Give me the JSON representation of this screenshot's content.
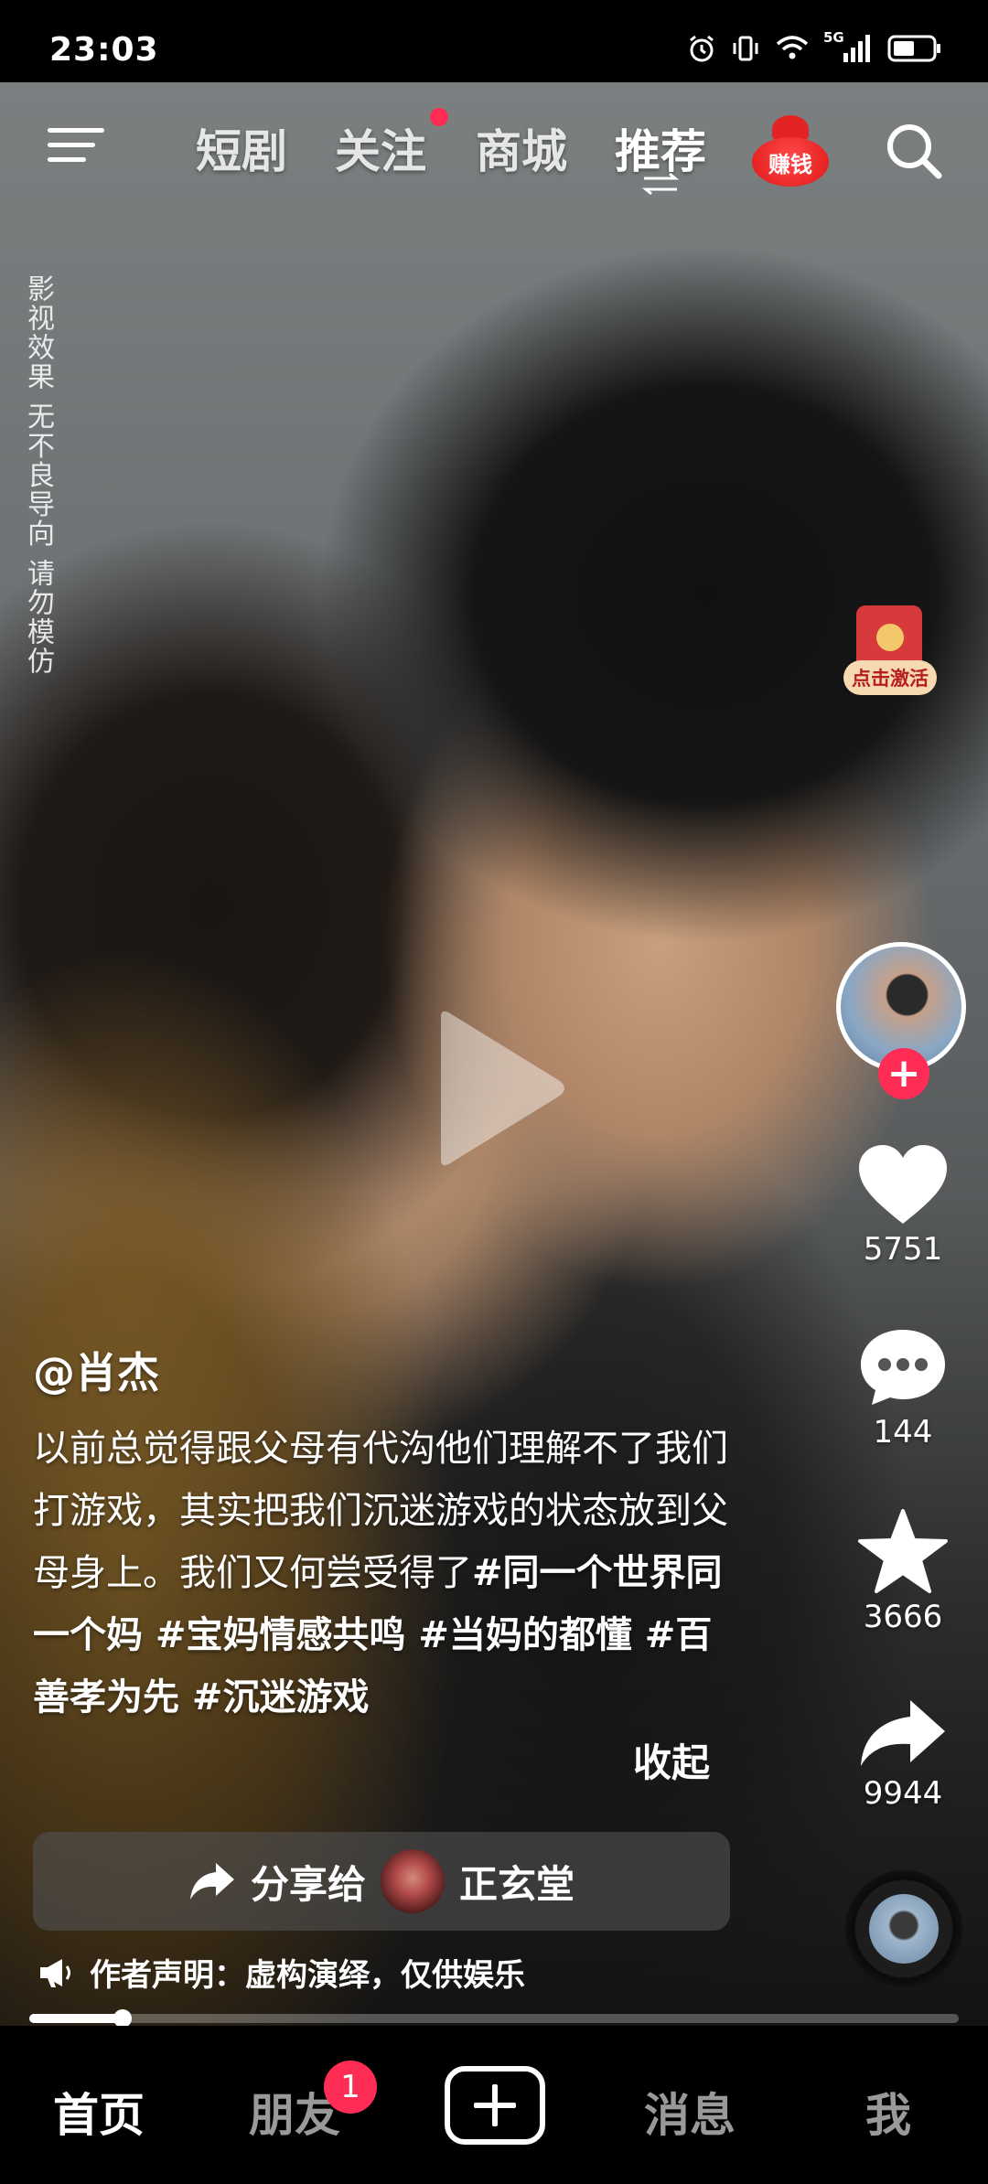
{
  "status_bar": {
    "time": "23:03",
    "network": "5G"
  },
  "top_nav": {
    "tabs": [
      "短剧",
      "关注",
      "商城",
      "推荐"
    ],
    "active_tab": "推荐",
    "money_label": "赚钱",
    "follow_has_dot": true
  },
  "watermark": {
    "text": "影视效果 无不良导向 请勿模仿"
  },
  "red_packet": {
    "label": "点击激活"
  },
  "actions": {
    "likes": "5751",
    "comments": "144",
    "favorites": "3666",
    "shares": "9944",
    "follow_symbol": "+"
  },
  "caption": {
    "author": "@肖杰",
    "text": "以前总觉得跟父母有代沟他们理解不了我们打游戏，其实把我们沉迷游戏的状态放到父母身上。我们又何尝受得了",
    "tags": "#同一个世界同一个妈 #宝妈情感共鸣 #当妈的都懂 #百善孝为先 #沉迷游戏",
    "collapse_label": "收起"
  },
  "share_bar": {
    "label": "分享给",
    "target": "正玄堂"
  },
  "declaration": {
    "text": "作者声明：虚构演绎，仅供娱乐"
  },
  "progress": {
    "fraction": 0.1
  },
  "bottom_nav": {
    "items": [
      "首页",
      "朋友",
      "消息",
      "我"
    ],
    "active": "首页",
    "friends_badge": "1"
  },
  "colors": {
    "accent": "#ff2c55",
    "money_red": "#e01616"
  }
}
